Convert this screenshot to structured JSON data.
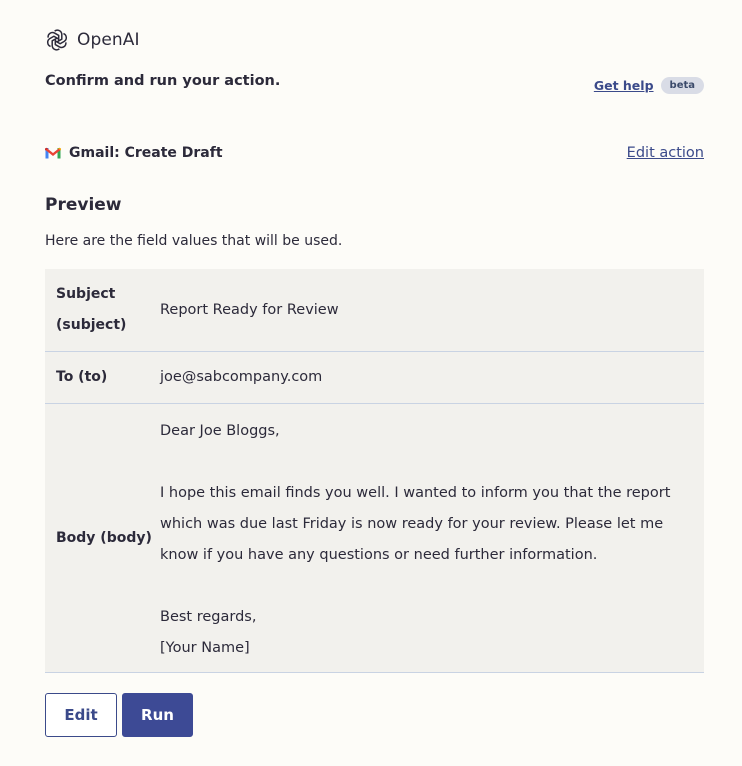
{
  "brand": {
    "name": "OpenAI",
    "icon": "openai-logo-icon"
  },
  "header": {
    "headline": "Confirm and run your action.",
    "help_link": "Get help",
    "badge": "beta"
  },
  "action": {
    "icon": "gmail-icon",
    "title": "Gmail: Create Draft",
    "edit_link": "Edit action"
  },
  "preview": {
    "heading": "Preview",
    "description": "Here are the field values that will be used."
  },
  "fields": [
    {
      "label": "Subject (subject)",
      "value": "Report Ready for Review"
    },
    {
      "label": "To (to)",
      "value": "joe@sabcompany.com"
    },
    {
      "label": "Body (body)",
      "value": "Dear Joe Bloggs,\n\nI hope this email finds you well. I wanted to inform you that the report which was due last Friday is now ready for your review. Please let me know if you have any questions or need further information.\n\nBest regards,\n[Your Name]"
    }
  ],
  "buttons": {
    "edit": "Edit",
    "run": "Run"
  },
  "colors": {
    "background": "#fdfcf8",
    "accent": "#3d4a95",
    "table_bg": "#f2f1ed",
    "divider": "#c9d3e3",
    "badge_bg": "#d9dce6"
  }
}
